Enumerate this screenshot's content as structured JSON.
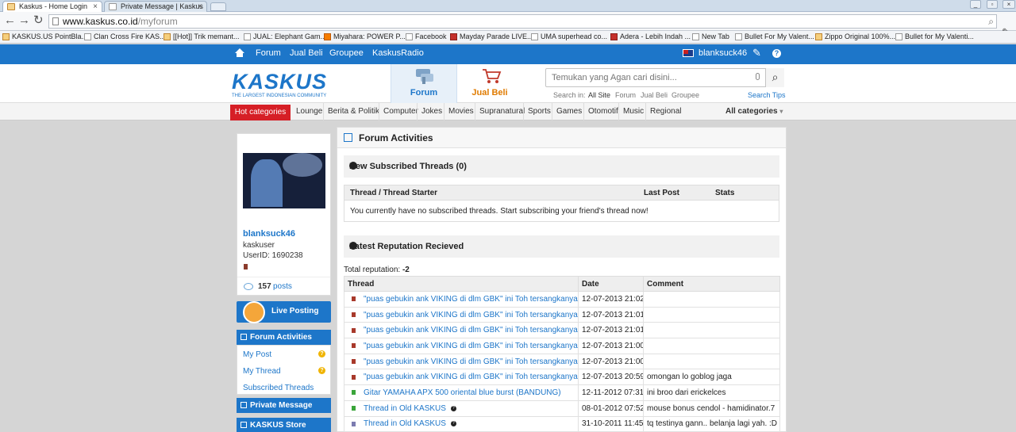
{
  "browser": {
    "tabs": [
      {
        "title": "Kaskus - Home Login",
        "active": true
      },
      {
        "title": "Private Message | Kaskus",
        "active": false
      }
    ],
    "url_main": "www.kaskus.co.id",
    "url_path": "/myforum",
    "bookmarks": [
      "KASKUS.US PointBla...",
      "Clan Cross Fire KAS...",
      "[[Hot]] Trik memant...",
      "JUAL: Elephant Gam...",
      "Miyahara: POWER P...",
      "Facebook",
      "Mayday Parade LIVE...",
      "UMA superhead co...",
      "Adera - Lebih Indah ...",
      "New Tab",
      "Bullet For My Valent...",
      "Zippo Original 100%...",
      "Bullet for My Valenti..."
    ]
  },
  "topnav": {
    "items": [
      "Forum",
      "Jual Beli",
      "Groupee",
      "KaskusRadio"
    ],
    "username": "blanksuck46",
    "help": "?"
  },
  "header": {
    "logo_word": "KASKUS",
    "logo_tagline": "THE LARGEST INDONESIAN COMMUNITY",
    "tab_forum": "Forum",
    "tab_jualbeli": "Jual Beli",
    "search_placeholder": "Temukan yang Agan cari disini...",
    "search_in_label": "Search in:",
    "search_in_options": [
      "All Site",
      "Forum",
      "Jual Beli",
      "Groupee"
    ],
    "search_tips": "Search Tips"
  },
  "categories": {
    "hot": "Hot categories",
    "items": [
      "Lounge",
      "Berita & Politik",
      "Computer",
      "Jokes",
      "Movies",
      "Supranatural",
      "Sports",
      "Games",
      "Otomotif",
      "Music",
      "Regional"
    ],
    "all": "All categories"
  },
  "sidebar": {
    "username": "blanksuck46",
    "role": "kaskuser",
    "user_id": "UserID: 1690238",
    "post_count": "157",
    "posts_label": "posts",
    "live_posting": "Live Posting",
    "forum_activities": "Forum Activities",
    "menu": [
      "My Post",
      "My Thread",
      "Subscribed Threads"
    ],
    "private_message": "Private Message",
    "kaskus_store": "KASKUS Store"
  },
  "main": {
    "title": "Forum Activities",
    "subscribed": {
      "heading": "New Subscribed Threads (0)",
      "col_thread": "Thread / Thread Starter",
      "col_last_post": "Last Post",
      "col_stats": "Stats",
      "empty_message": "You currently have no subscribed threads. Start subscribing your friend's thread now!"
    },
    "reputation": {
      "heading": "Latest Reputation Recieved",
      "total_label": "Total reputation:",
      "total_value": "-2",
      "col_thread": "Thread",
      "col_date": "Date",
      "col_comment": "Comment",
      "rows": [
        {
          "thread": "\"puas gebukin ank VIKING di dlm GBK\" ini Toh tersangkanya",
          "date": "12-07-2013 21:02",
          "comment": "",
          "color": "#a8392b",
          "help": false
        },
        {
          "thread": "\"puas gebukin ank VIKING di dlm GBK\" ini Toh tersangkanya",
          "date": "12-07-2013 21:01",
          "comment": "",
          "color": "#a8392b",
          "help": false
        },
        {
          "thread": "\"puas gebukin ank VIKING di dlm GBK\" ini Toh tersangkanya",
          "date": "12-07-2013 21:01",
          "comment": "",
          "color": "#a8392b",
          "help": false
        },
        {
          "thread": "\"puas gebukin ank VIKING di dlm GBK\" ini Toh tersangkanya",
          "date": "12-07-2013 21:00",
          "comment": "",
          "color": "#a8392b",
          "help": false
        },
        {
          "thread": "\"puas gebukin ank VIKING di dlm GBK\" ini Toh tersangkanya",
          "date": "12-07-2013 21:00",
          "comment": "",
          "color": "#a8392b",
          "help": false
        },
        {
          "thread": "\"puas gebukin ank VIKING di dlm GBK\" ini Toh tersangkanya",
          "date": "12-07-2013 20:59",
          "comment": "omongan lo goblog jaga",
          "color": "#a8392b",
          "help": false
        },
        {
          "thread": "Gitar YAMAHA APX 500 oriental blue burst (BANDUNG)",
          "date": "12-11-2012 07:31",
          "comment": "ini broo dari erickelces",
          "color": "#3aa53a",
          "help": false
        },
        {
          "thread": "Thread in Old KASKUS",
          "date": "08-01-2012 07:52",
          "comment": "mouse bonus cendol - hamidinator.7",
          "color": "#3aa53a",
          "help": true
        },
        {
          "thread": "Thread in Old KASKUS",
          "date": "31-10-2011 11:45",
          "comment": "tq testinya gann.. belanja lagi yah. :D",
          "color": "#7c7cb0",
          "help": true
        }
      ]
    }
  },
  "colors": {
    "brand_blue": "#1d76c9",
    "hot_red": "#d61f26",
    "jualbeli_orange": "#e07b00"
  }
}
